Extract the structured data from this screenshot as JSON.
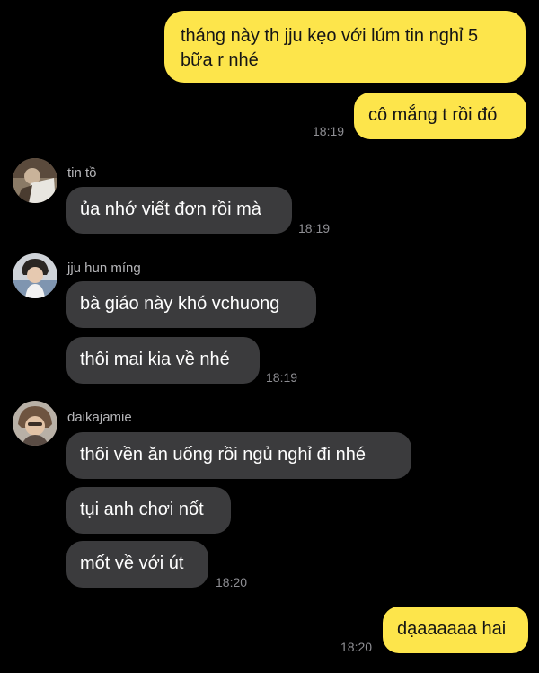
{
  "colors": {
    "background": "#000000",
    "outgoing_bubble": "#FDE54B",
    "incoming_bubble": "#3B3B3D",
    "timestamp": "#8E8E93",
    "sender_name": "#B5B5B8"
  },
  "messages": {
    "out1": {
      "line1": "tháng này th jju kẹo với lúm tin nghỉ 5",
      "line2": "bữa r nhé"
    },
    "out2": {
      "text": "cô mắng t rồi đó",
      "time": "18:19"
    },
    "group1": {
      "sender": "tin tồ",
      "avatar_icon": "user-avatar-icon",
      "text": "ủa nhớ viết đơn rồi mà",
      "time": "18:19"
    },
    "group2": {
      "sender": "jju hun míng",
      "avatar_icon": "user-avatar-icon",
      "text1": "bà giáo này khó vchuong",
      "text2": "thôi mai kia về nhé",
      "time": "18:19"
    },
    "group3": {
      "sender": "daikajamie",
      "avatar_icon": "user-avatar-icon",
      "text1": "thôi vền ăn uống rồi ngủ nghỉ đi nhé",
      "text2": "tụi anh chơi nốt",
      "text3": "mốt về với út",
      "time": "18:20"
    },
    "out3": {
      "text": "dạaaaaaa hai",
      "time": "18:20"
    }
  }
}
